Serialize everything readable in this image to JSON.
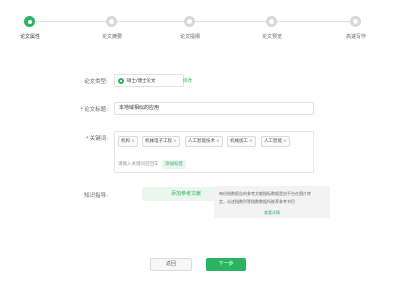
{
  "stepper": {
    "steps": [
      {
        "label": "论文属性",
        "state": "active"
      },
      {
        "label": "论文摘要",
        "state": "todo"
      },
      {
        "label": "论文提纲",
        "state": "todo"
      },
      {
        "label": "论文预览",
        "state": "todo"
      },
      {
        "label": "高速写作",
        "state": "todo"
      }
    ]
  },
  "form": {
    "type": {
      "label": "论文类型:",
      "value": "硕士/博士论文",
      "change_label": "修改"
    },
    "title": {
      "label": "论文标题:",
      "value": "本地域相似的应用"
    },
    "keywords": {
      "label": "关键词:",
      "tags": [
        "机构",
        "机械电子工程",
        "人工智能技术",
        "机械加工",
        "人工智能"
      ],
      "input_placeholder": "请输入关键词后回车",
      "add_label": "添加标签"
    },
    "reference": {
      "label": "知识指导:",
      "button_label": "添加参考文献",
      "tip_line1": "每份指数报告的参考文献指标数据是由平台在图片库",
      "tip_line2": "定，论述指数列等指数数据所推荐参考书目",
      "tip_link": "查看详情"
    }
  },
  "footer": {
    "back_label": "返回",
    "next_label": "下一步"
  },
  "colors": {
    "accent": "#2ab45f",
    "required": "#e54d42"
  }
}
